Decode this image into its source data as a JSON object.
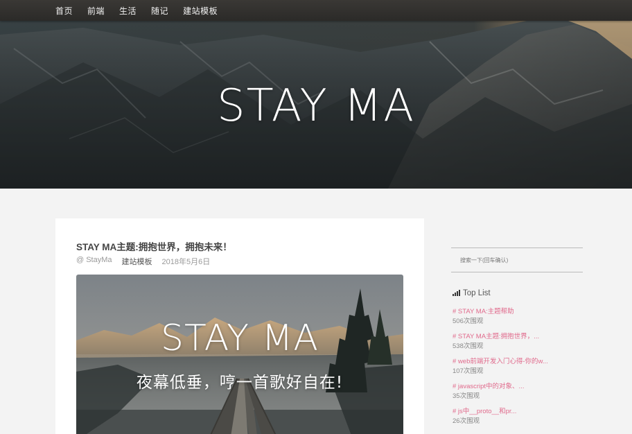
{
  "nav": {
    "items": [
      "首页",
      "前端",
      "生活",
      "随记",
      "建站模板"
    ]
  },
  "hero": {
    "title": "STAY MA"
  },
  "post": {
    "title": "STAY MA主题:拥抱世界，拥抱未来！",
    "author": "@ StayMa",
    "category": "建站模板",
    "date": "2018年5月6日",
    "thumbnail_title": "STAY MA",
    "thumbnail_subtitle": "夜幕低垂，哼一首歌好自在!"
  },
  "sidebar": {
    "search_placeholder": "搜索一下(回车确认)",
    "toplist_title": "Top List",
    "items": [
      {
        "title": "# STAY MA:主题帮助",
        "views": "506次围观"
      },
      {
        "title": "# STAY MA主题:拥抱世界，...",
        "views": "538次围观"
      },
      {
        "title": "# web前端开发入门心得-你的w...",
        "views": "107次围观"
      },
      {
        "title": "# javascript中的对象、...",
        "views": "35次围观"
      },
      {
        "title": "# js中__proto__和pr...",
        "views": "26次围观"
      }
    ]
  },
  "colors": {
    "nav_bg": "#2f2d2b",
    "page_bg": "#f3f3f3",
    "toplist_link": "#e0698b"
  }
}
